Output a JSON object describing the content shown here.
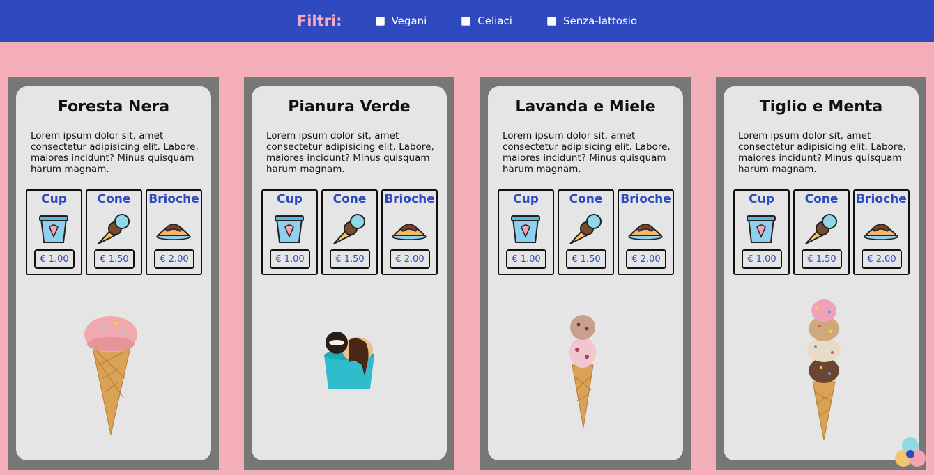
{
  "filters": {
    "title": "Filtri:",
    "options": [
      {
        "label": "Vegani",
        "checked": false
      },
      {
        "label": "Celiaci",
        "checked": false
      },
      {
        "label": "Senza-lattosio",
        "checked": false
      }
    ]
  },
  "colors": {
    "accent": "#2f49bf",
    "background": "#f3aeb8",
    "filter_title": "#f6a9c0",
    "card": "#e5e5e5",
    "card_frame": "#777777"
  },
  "cards": [
    {
      "title": "Foresta Nera",
      "description": "Lorem ipsum dolor sit, amet consectetur adipisicing elit. Labore, maiores incidunt? Minus quisquam harum magnam.",
      "options": [
        {
          "label": "Cup",
          "icon": "ice-cream-cup-icon",
          "price": "€ 1.00"
        },
        {
          "label": "Cone",
          "icon": "ice-cream-cone-icon",
          "price": "€ 1.50"
        },
        {
          "label": "Brioche",
          "icon": "brioche-icon",
          "price": "€ 2.00"
        }
      ],
      "image": "pink-gelato-cone"
    },
    {
      "title": "Pianura Verde",
      "description": "Lorem ipsum dolor sit, amet consectetur adipisicing elit. Labore, maiores incidunt? Minus quisquam harum magnam.",
      "options": [
        {
          "label": "Cup",
          "icon": "ice-cream-cup-icon",
          "price": "€ 1.00"
        },
        {
          "label": "Cone",
          "icon": "ice-cream-cone-icon",
          "price": "€ 1.50"
        },
        {
          "label": "Brioche",
          "icon": "brioche-icon",
          "price": "€ 2.00"
        }
      ],
      "image": "cookie-gelato-cup"
    },
    {
      "title": "Lavanda e Miele",
      "description": "Lorem ipsum dolor sit, amet consectetur adipisicing elit. Labore, maiores incidunt? Minus quisquam harum magnam.",
      "options": [
        {
          "label": "Cup",
          "icon": "ice-cream-cup-icon",
          "price": "€ 1.00"
        },
        {
          "label": "Cone",
          "icon": "ice-cream-cone-icon",
          "price": "€ 1.50"
        },
        {
          "label": "Brioche",
          "icon": "brioche-icon",
          "price": "€ 2.00"
        }
      ],
      "image": "two-scoop-cone"
    },
    {
      "title": "Tiglio e Menta",
      "description": "Lorem ipsum dolor sit, amet consectetur adipisicing elit. Labore, maiores incidunt? Minus quisquam harum magnam.",
      "options": [
        {
          "label": "Cup",
          "icon": "ice-cream-cup-icon",
          "price": "€ 1.00"
        },
        {
          "label": "Cone",
          "icon": "ice-cream-cone-icon",
          "price": "€ 1.50"
        },
        {
          "label": "Brioche",
          "icon": "brioche-icon",
          "price": "€ 2.00"
        }
      ],
      "image": "sprinkles-tower-cone"
    }
  ]
}
